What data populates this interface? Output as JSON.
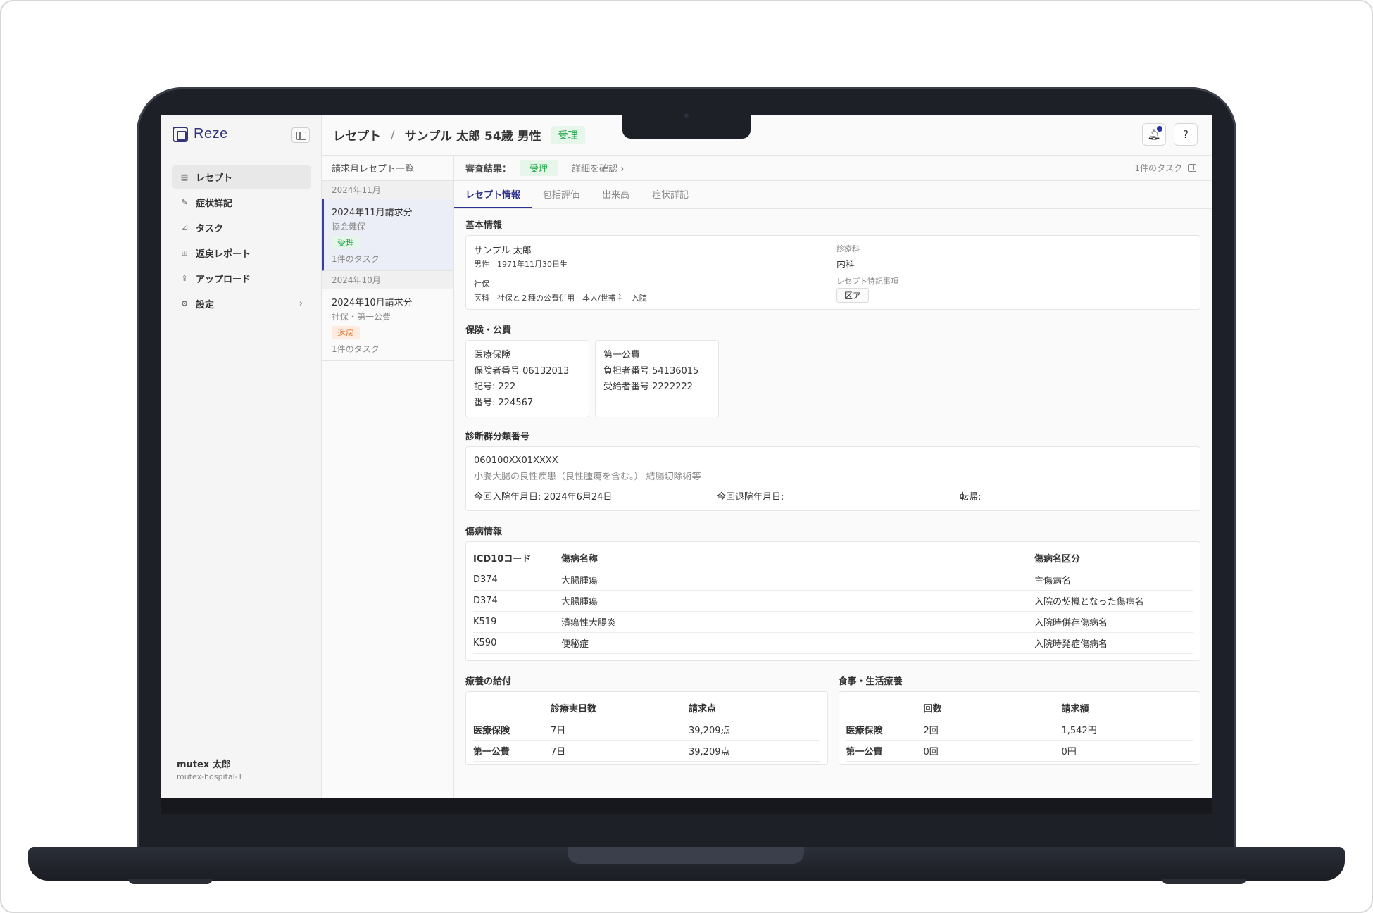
{
  "app": {
    "logo": "Reze"
  },
  "sidebar": {
    "items": [
      {
        "label": "レセプト",
        "icon": "document-icon"
      },
      {
        "label": "症状詳記",
        "icon": "pencil-icon"
      },
      {
        "label": "タスク",
        "icon": "checkbox-icon"
      },
      {
        "label": "返戻レポート",
        "icon": "grid-icon"
      },
      {
        "label": "アップロード",
        "icon": "upload-file-icon"
      },
      {
        "label": "設定",
        "icon": "gear-icon"
      }
    ],
    "user": {
      "name": "mutex 太郎",
      "org": "mutex-hospital-1"
    }
  },
  "header": {
    "crumb_root": "レセプト",
    "crumb_sep": "/",
    "patient": "サンプル 太郎 54歳 男性",
    "status": "受理"
  },
  "list": {
    "title": "請求月レセプト一覧",
    "groups": [
      {
        "month": "2024年11月",
        "title": "2024年11月請求分",
        "sub": "協会健保",
        "badge": "受理",
        "tasks": "1件のタスク"
      },
      {
        "month": "2024年10月",
        "title": "2024年10月請求分",
        "sub": "社保・第一公費",
        "badge": "返戻",
        "tasks": "1件のタスク"
      }
    ]
  },
  "review": {
    "label": "審査結果：",
    "badge": "受理",
    "link": "詳細を確認",
    "tasks": "1件のタスク"
  },
  "tabs": [
    "レセプト情報",
    "包括評価",
    "出来高",
    "症状詳記"
  ],
  "basic": {
    "title": "基本情報",
    "name": "サンプル 太郎",
    "sex_dob": "男性　1971年11月30日生",
    "ins_label": "社保",
    "ins_value": "医科　社保と２種の公費併用　本人/世帯主　入院",
    "dept_label": "診療科",
    "dept_value": "内科",
    "note_label": "レセプト特記事項",
    "note_value": "区ア"
  },
  "insurance": {
    "title": "保険・公費",
    "cards": [
      {
        "title": "医療保険",
        "lines": [
          "保険者番号  06132013",
          "記号: 222",
          "番号: 224567"
        ]
      },
      {
        "title": "第一公費",
        "lines": [
          "負担者番号 54136015",
          "受給者番号 2222222"
        ]
      }
    ]
  },
  "dpc": {
    "title": "診断群分類番号",
    "code": "060100XX01XXXX",
    "desc": "小腸大腸の良性疾患（良性腫瘍を含む。） 結腸切除術等",
    "admit": "今回入院年月日:  2024年6月24日",
    "discharge": "今回退院年月日:",
    "outcome": "転帰:"
  },
  "disease": {
    "title": "傷病情報",
    "headers": [
      "ICD10コード",
      "傷病名称",
      "傷病名区分"
    ],
    "rows": [
      [
        "D374",
        "大腸腫瘍",
        "主傷病名"
      ],
      [
        "D374",
        "大腸腫瘍",
        "入院の契機となった傷病名"
      ],
      [
        "K519",
        "潰瘍性大腸炎",
        "入院時併存傷病名"
      ],
      [
        "K590",
        "便秘症",
        "入院時発症傷病名"
      ]
    ]
  },
  "benefit": {
    "title": "療養の給付",
    "headers": [
      "",
      "診療実日数",
      "請求点"
    ],
    "rows": [
      [
        "医療保険",
        "7日",
        "39,209点"
      ],
      [
        "第一公費",
        "7日",
        "39,209点"
      ]
    ]
  },
  "meal": {
    "title": "食事・生活療養",
    "headers": [
      "",
      "回数",
      "請求額"
    ],
    "rows": [
      [
        "医療保険",
        "2回",
        "1,542円"
      ],
      [
        "第一公費",
        "0回",
        "0円"
      ]
    ]
  }
}
